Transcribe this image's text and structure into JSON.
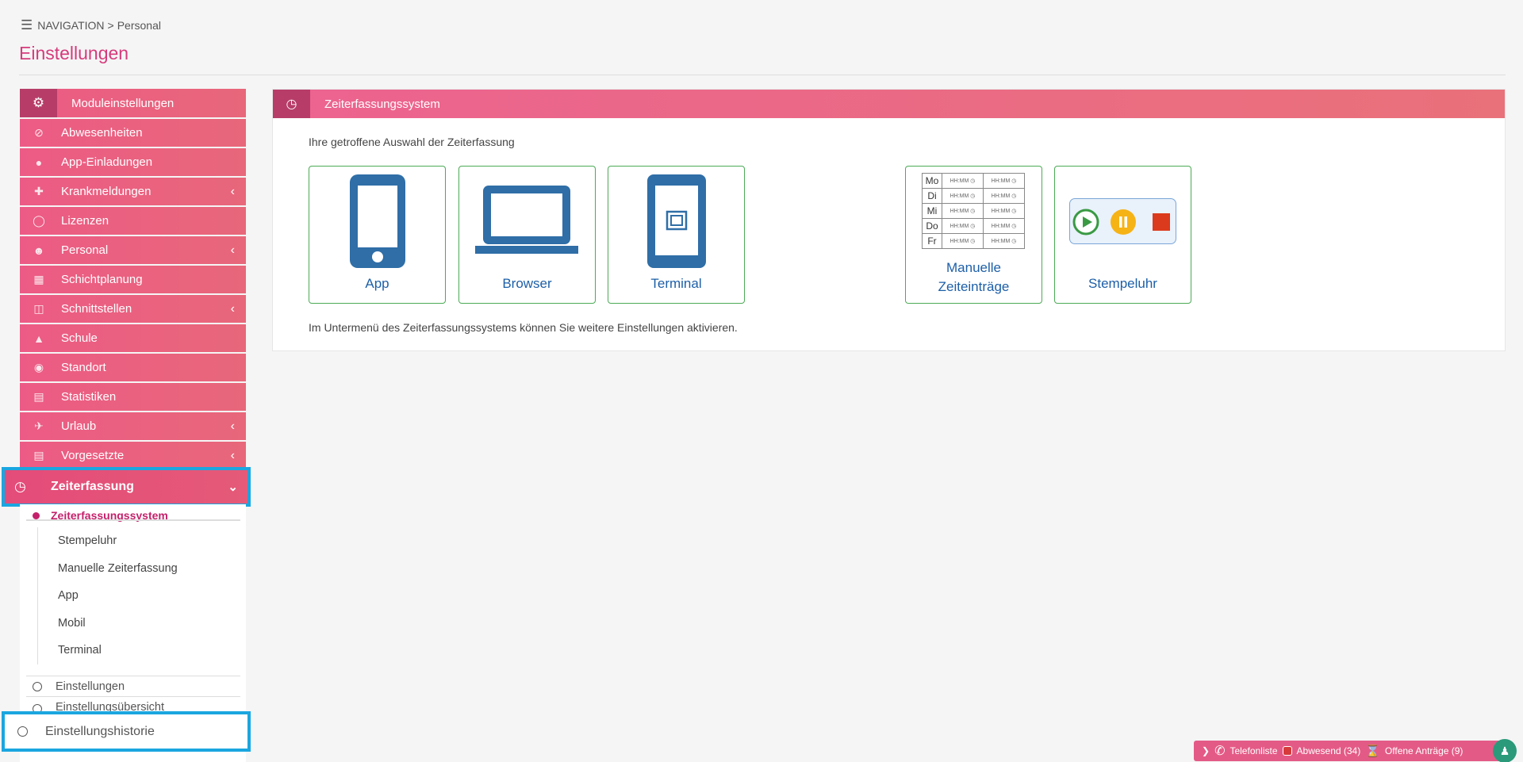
{
  "breadcrumb": {
    "nav": "NAVIGATION",
    "separator": ">",
    "current": "Personal"
  },
  "page_title": "Einstellungen",
  "sidebar": {
    "header": "Moduleinstellungen",
    "items": [
      {
        "label": "Abwesenheiten",
        "icon": "ban-icon",
        "has_chevron": false
      },
      {
        "label": "App-Einladungen",
        "icon": "user-icon",
        "has_chevron": false
      },
      {
        "label": "Krankmeldungen",
        "icon": "medical-icon",
        "has_chevron": true
      },
      {
        "label": "Lizenzen",
        "icon": "circle-icon",
        "has_chevron": false
      },
      {
        "label": "Personal",
        "icon": "users-icon",
        "has_chevron": true
      },
      {
        "label": "Schichtplanung",
        "icon": "calendar-icon",
        "has_chevron": false
      },
      {
        "label": "Schnittstellen",
        "icon": "sitemap-icon",
        "has_chevron": true
      },
      {
        "label": "Schule",
        "icon": "graduation-icon",
        "has_chevron": false
      },
      {
        "label": "Standort",
        "icon": "location-icon",
        "has_chevron": false
      },
      {
        "label": "Statistiken",
        "icon": "chart-icon",
        "has_chevron": false
      },
      {
        "label": "Urlaub",
        "icon": "plane-icon",
        "has_chevron": true
      },
      {
        "label": "Vorgesetzte",
        "icon": "chart-icon",
        "has_chevron": true
      }
    ],
    "active_section": "Zeiterfassung",
    "active_sub": "Zeiterfassungssystem",
    "sub_items": [
      "Stempeluhr",
      "Manuelle Zeiterfassung",
      "App",
      "Mobil",
      "Terminal"
    ],
    "options": [
      "Einstellungen",
      "Einstellungsübersicht"
    ],
    "history": "Einstellungshistorie"
  },
  "panel": {
    "title": "Zeiterfassungssystem",
    "intro": "Ihre getroffene Auswahl der Zeiterfassung",
    "hint": "Im Untermenü des Zeiterfassungssystems können Sie weitere Einstellungen aktivieren.",
    "cards": {
      "app": "App",
      "browser": "Browser",
      "terminal": "Terminal",
      "manual_line1": "Manuelle",
      "manual_line2": "Zeiteinträge",
      "stempeluhr": "Stempeluhr"
    },
    "manual_table": {
      "days": [
        "Mo",
        "Di",
        "Mi",
        "Do",
        "Fr"
      ],
      "placeholder": "HH:MM"
    }
  },
  "statusbar": {
    "phone": "Telefonliste",
    "absent": "Abwesend (34)",
    "requests": "Offene Anträge (9)"
  },
  "colors": {
    "accent": "#e85c82",
    "dark_accent": "#b73d68",
    "highlight": "#1aa6e0",
    "card_border": "#4caa55",
    "link_blue": "#1d5fa8"
  }
}
